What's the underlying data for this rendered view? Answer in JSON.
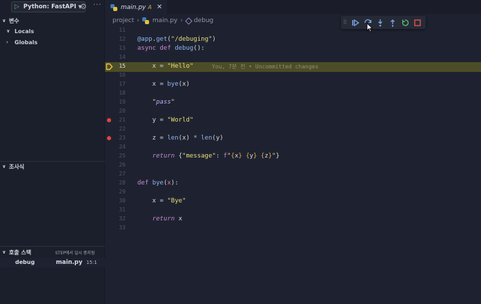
{
  "sidebar": {
    "run_config": "Python: FastAPI",
    "variables_title": "변수",
    "scopes": [
      "Locals",
      "Globals"
    ],
    "watch_title": "조사식",
    "callstack_title": "호출 스택",
    "callstack_state": "STEP에서 일시 중지됨",
    "frame": {
      "function": "debug",
      "file": "main.py",
      "position": "15:1"
    }
  },
  "tab": {
    "title": "main.py",
    "modified": "A"
  },
  "breadcrumb": [
    "project",
    "main.py",
    "debug"
  ],
  "blame": "You, 7분 전 • Uncommitted changes",
  "debug_toolbar": [
    "continue",
    "step-over",
    "step-into",
    "step-out",
    "restart",
    "stop"
  ],
  "code": [
    {
      "n": "11",
      "tokens": []
    },
    {
      "n": "12",
      "tokens": [
        [
          "dec",
          "@app"
        ],
        [
          "",
          "."
        ],
        [
          "fn",
          "get"
        ],
        [
          "",
          "("
        ],
        [
          "str",
          "\"/debuging\""
        ],
        [
          "",
          ")"
        ]
      ]
    },
    {
      "n": "13",
      "tokens": [
        [
          "kw",
          "async"
        ],
        [
          "",
          " "
        ],
        [
          "kw",
          "def"
        ],
        [
          "",
          " "
        ],
        [
          "fn",
          "debug"
        ],
        [
          "",
          "():"
        ]
      ]
    },
    {
      "n": "14",
      "tokens": []
    },
    {
      "n": "15",
      "tokens": [
        [
          "",
          "    x = "
        ],
        [
          "str",
          "\"Hello\""
        ]
      ],
      "current": true
    },
    {
      "n": "16",
      "tokens": []
    },
    {
      "n": "17",
      "tokens": [
        [
          "",
          "    x = "
        ],
        [
          "fn",
          "bye"
        ],
        [
          "",
          "(x)"
        ]
      ]
    },
    {
      "n": "18",
      "tokens": []
    },
    {
      "n": "19",
      "tokens": [
        [
          "",
          "    "
        ],
        [
          "str",
          "\""
        ],
        [
          "strm",
          "pass"
        ],
        [
          "str",
          "\""
        ]
      ]
    },
    {
      "n": "20",
      "tokens": []
    },
    {
      "n": "21",
      "tokens": [
        [
          "",
          "    y = "
        ],
        [
          "str",
          "\"World\""
        ]
      ],
      "breakpoint": true
    },
    {
      "n": "22",
      "tokens": []
    },
    {
      "n": "23",
      "tokens": [
        [
          "",
          "    z = "
        ],
        [
          "fn",
          "len"
        ],
        [
          "",
          "(x) "
        ],
        [
          "op",
          "*"
        ],
        [
          "",
          " "
        ],
        [
          "fn",
          "len"
        ],
        [
          "",
          "(y)"
        ]
      ],
      "breakpoint": true
    },
    {
      "n": "24",
      "tokens": []
    },
    {
      "n": "25",
      "tokens": [
        [
          "",
          "    "
        ],
        [
          "kwi",
          "return"
        ],
        [
          "",
          " {"
        ],
        [
          "str",
          "\"message\""
        ],
        [
          "",
          ": "
        ],
        [
          "fstr-b",
          "f"
        ],
        [
          "str",
          "\""
        ],
        [
          "brace",
          "{"
        ],
        [
          "",
          "x"
        ],
        [
          "brace",
          "}"
        ],
        [
          "str",
          " "
        ],
        [
          "brace",
          "{"
        ],
        [
          "",
          "y"
        ],
        [
          "brace",
          "}"
        ],
        [
          "str",
          " "
        ],
        [
          "brace",
          "{"
        ],
        [
          "",
          "z"
        ],
        [
          "brace",
          "}"
        ],
        [
          "str",
          "\""
        ],
        [
          "",
          "}"
        ]
      ]
    },
    {
      "n": "26",
      "tokens": []
    },
    {
      "n": "27",
      "tokens": []
    },
    {
      "n": "28",
      "tokens": [
        [
          "kw",
          "def"
        ],
        [
          "",
          " "
        ],
        [
          "fn",
          "bye"
        ],
        [
          "",
          "("
        ],
        [
          "prm",
          "x"
        ],
        [
          "",
          "):"
        ]
      ]
    },
    {
      "n": "29",
      "tokens": []
    },
    {
      "n": "30",
      "tokens": [
        [
          "",
          "    x = "
        ],
        [
          "str",
          "\"Bye\""
        ]
      ]
    },
    {
      "n": "31",
      "tokens": []
    },
    {
      "n": "32",
      "tokens": [
        [
          "",
          "    "
        ],
        [
          "kwi",
          "return"
        ],
        [
          "",
          " x"
        ]
      ]
    },
    {
      "n": "33",
      "tokens": []
    }
  ]
}
